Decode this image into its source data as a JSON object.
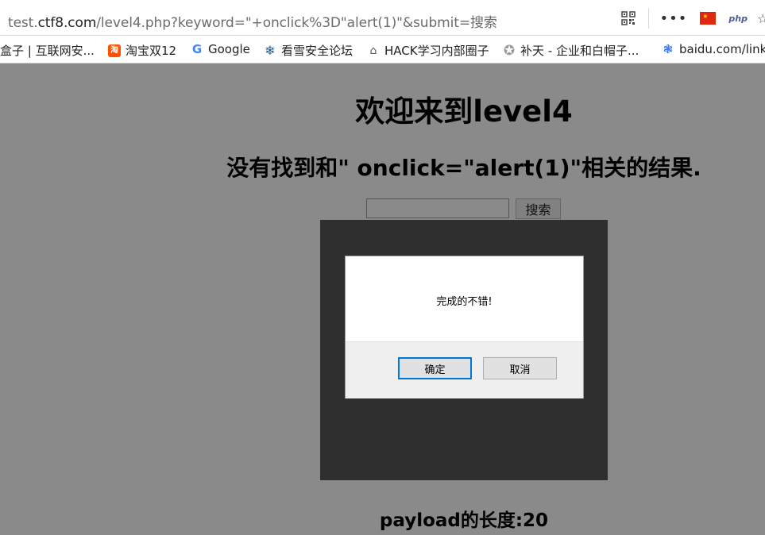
{
  "browser": {
    "url_prefix": "test.",
    "url_host": "ctf8.com",
    "url_rest": "/level4.php?keyword=\"+onclick%3D\"alert(1)\"&submit=搜索",
    "toolbar": {
      "menu_label": "•••",
      "flag_icon": "china-flag-icon",
      "php_label": "php"
    }
  },
  "bookmarks": [
    {
      "label": "盒子 | 互联网安...",
      "icon": "none"
    },
    {
      "label": "淘宝双12",
      "icon": "taobao-icon",
      "icon_text": "淘"
    },
    {
      "label": "Google",
      "icon": "google-icon",
      "icon_text": "G"
    },
    {
      "label": "看雪安全论坛",
      "icon": "snowflake-icon",
      "icon_text": "❄"
    },
    {
      "label": "HACK学习内部圈子",
      "icon": "hack-icon",
      "icon_text": "⌂"
    },
    {
      "label": "补天 - 企业和白帽子...",
      "icon": "star-icon",
      "icon_text": "✪"
    },
    {
      "label": "baidu.com/link",
      "icon": "paw-icon",
      "icon_text": "❃"
    }
  ],
  "page": {
    "title": "欢迎来到level4",
    "result_text": "没有找到和\" onclick=\"alert(1)\"相关的结果.",
    "search_value": "",
    "search_button": "搜索",
    "payload_length": "payload的长度:20"
  },
  "dialog": {
    "message": "完成的不错!",
    "ok_label": "确定",
    "cancel_label": "取消"
  }
}
